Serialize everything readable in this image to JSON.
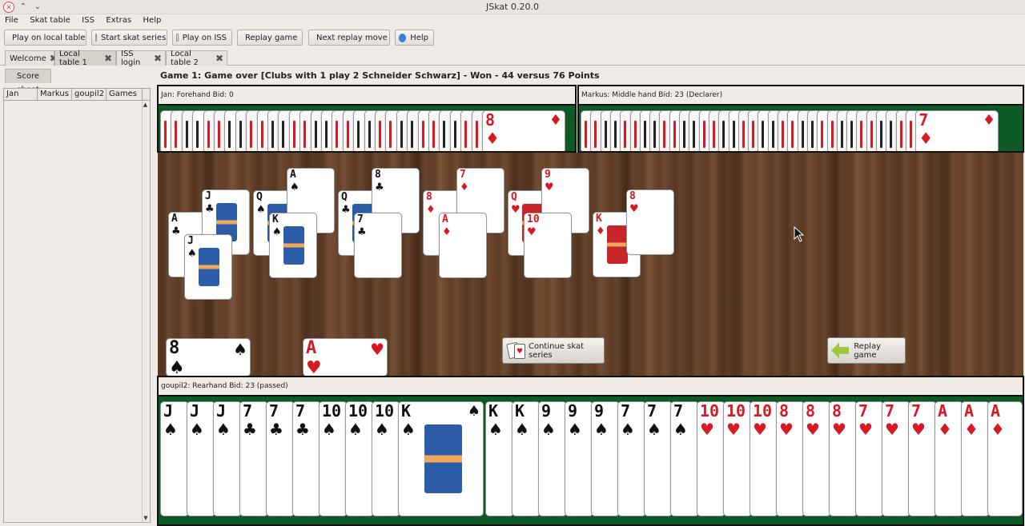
{
  "window": {
    "title": "JSkat 0.20.0"
  },
  "menu": [
    "File",
    "Skat table",
    "ISS",
    "Extras",
    "Help"
  ],
  "toolbar": {
    "play_local": "Play on local table",
    "start_series": "Start skat series",
    "play_iss": "Play on ISS",
    "replay_game": "Replay game",
    "next_replay": "Next replay move",
    "help": "Help"
  },
  "tabs": [
    {
      "label": "Welcome"
    },
    {
      "label": "Local table 1"
    },
    {
      "label": "ISS login"
    },
    {
      "label": "Local table 2"
    }
  ],
  "score_sheet": {
    "tab": "Score sheet",
    "columns": [
      "Jan",
      "Markus",
      "goupil2",
      "Games"
    ]
  },
  "game_info": "Game 1: Game over [Clubs with 1 play 2 Schneider Schwarz] - Won - 44 versus 76 Points",
  "players": {
    "forehand": "Jan: Forehand Bid: 0",
    "middlehand": "Markus: Middle hand Bid: 23 (Declarer)",
    "rearhand": "goupil2: Rearhand Bid: 23 (passed)"
  },
  "opponent_top_cards": {
    "jan_last": {
      "rank": "8",
      "suit": "♦"
    },
    "markus_last": {
      "rank": "7",
      "suit": "♦"
    }
  },
  "tricks": [
    [
      {
        "rank": "A",
        "suit": "♣"
      },
      {
        "rank": "J",
        "suit": "♣"
      },
      {
        "rank": "J",
        "suit": "♠"
      }
    ],
    [
      {
        "rank": "Q",
        "suit": "♠"
      },
      {
        "rank": "A",
        "suit": "♠"
      },
      {
        "rank": "K",
        "suit": "♠"
      }
    ],
    [
      {
        "rank": "Q",
        "suit": "♣"
      },
      {
        "rank": "8",
        "suit": "♣"
      },
      {
        "rank": "7",
        "suit": "♣"
      }
    ],
    [
      {
        "rank": "8",
        "suit": "♦"
      },
      {
        "rank": "7",
        "suit": "♦"
      },
      {
        "rank": "A",
        "suit": "♦"
      }
    ],
    [
      {
        "rank": "Q",
        "suit": "♥"
      },
      {
        "rank": "9",
        "suit": "♥"
      },
      {
        "rank": "10",
        "suit": "♥"
      }
    ],
    [
      {
        "rank": "K",
        "suit": "♦"
      },
      {
        "rank": "8",
        "suit": "♥"
      }
    ]
  ],
  "skat": [
    {
      "rank": "8",
      "suit": "♠"
    },
    {
      "rank": "A",
      "suit": "♥"
    }
  ],
  "buttons": {
    "continue_series": "Continue skat series",
    "replay_game": "Replay game"
  },
  "rearhand_cards": [
    {
      "rank": "J",
      "suit": "♠"
    },
    {
      "rank": "J",
      "suit": "♠"
    },
    {
      "rank": "J",
      "suit": "♠"
    },
    {
      "rank": "7",
      "suit": "♣"
    },
    {
      "rank": "7",
      "suit": "♣"
    },
    {
      "rank": "7",
      "suit": "♣"
    },
    {
      "rank": "10",
      "suit": "♠"
    },
    {
      "rank": "10",
      "suit": "♠"
    },
    {
      "rank": "10",
      "suit": "♠"
    },
    {
      "rank": "K",
      "suit": "♠"
    },
    {
      "rank": "K",
      "suit": "♠"
    },
    {
      "rank": "K",
      "suit": "♠"
    },
    {
      "rank": "9",
      "suit": "♠"
    },
    {
      "rank": "9",
      "suit": "♠"
    },
    {
      "rank": "9",
      "suit": "♠"
    },
    {
      "rank": "7",
      "suit": "♠"
    },
    {
      "rank": "7",
      "suit": "♠"
    },
    {
      "rank": "7",
      "suit": "♠"
    },
    {
      "rank": "10",
      "suit": "♥"
    },
    {
      "rank": "10",
      "suit": "♥"
    },
    {
      "rank": "10",
      "suit": "♥"
    },
    {
      "rank": "8",
      "suit": "♥"
    },
    {
      "rank": "8",
      "suit": "♥"
    },
    {
      "rank": "8",
      "suit": "♥"
    },
    {
      "rank": "7",
      "suit": "♥"
    },
    {
      "rank": "7",
      "suit": "♥"
    },
    {
      "rank": "7",
      "suit": "♥"
    },
    {
      "rank": "A",
      "suit": "♦"
    },
    {
      "rank": "A",
      "suit": "♦"
    },
    {
      "rank": "A",
      "suit": "♦"
    }
  ],
  "colors": {
    "felt": "#0d5a26",
    "red_suit": "#d71921",
    "wood": "#5a3822"
  }
}
